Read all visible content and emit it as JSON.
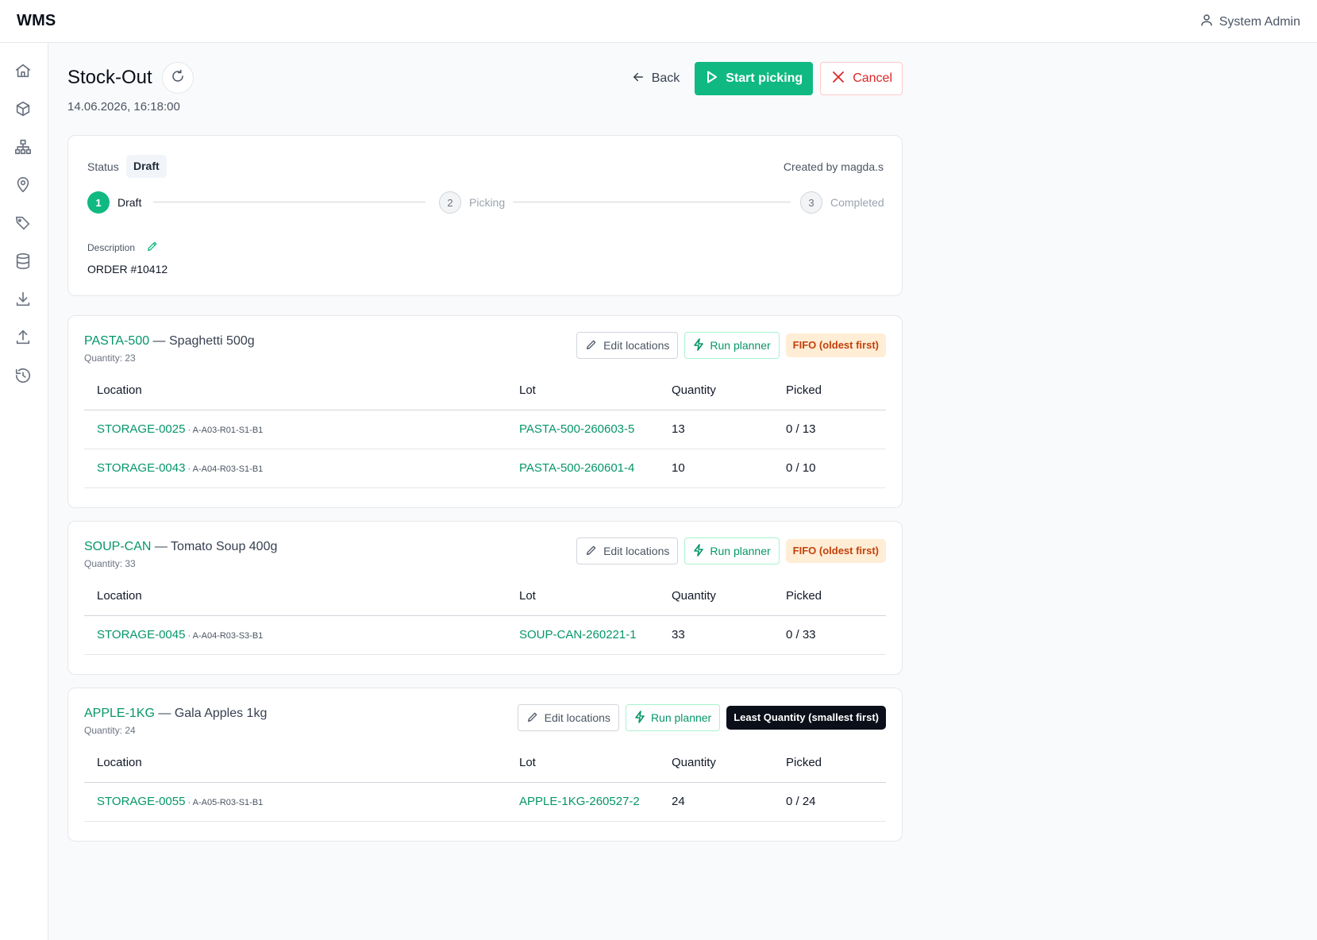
{
  "app": {
    "brand": "WMS",
    "user": "System Admin"
  },
  "sidebar": {
    "items": [
      {
        "icon": "home-icon"
      },
      {
        "icon": "box-icon"
      },
      {
        "icon": "hierarchy-icon"
      },
      {
        "icon": "location-pin-icon"
      },
      {
        "icon": "tags-icon"
      },
      {
        "icon": "database-icon"
      },
      {
        "icon": "download-icon"
      },
      {
        "icon": "upload-icon"
      },
      {
        "icon": "history-icon"
      }
    ]
  },
  "page": {
    "title": "Stock-Out",
    "timestamp": "14.06.2026, 16:18:00",
    "actions": {
      "back": "Back",
      "start": "Start picking",
      "cancel": "Cancel"
    }
  },
  "status": {
    "label": "Status",
    "value": "Draft",
    "created_by": "Created by magda.s",
    "steps": [
      {
        "num": "1",
        "label": "Draft",
        "state": "active"
      },
      {
        "num": "2",
        "label": "Picking",
        "state": "idle"
      },
      {
        "num": "3",
        "label": "Completed",
        "state": "idle"
      }
    ],
    "description_label": "Description",
    "description": "ORDER #10412"
  },
  "colors": {
    "accent": "#10b981",
    "link": "#059669",
    "danger": "#dc2626",
    "fifo_bg": "#ffedd5",
    "fifo_fg": "#c2410c"
  },
  "table_headers": {
    "location": "Location",
    "lot": "Lot",
    "quantity": "Quantity",
    "picked": "Picked"
  },
  "item_buttons": {
    "edit": "Edit locations",
    "run": "Run planner"
  },
  "items": [
    {
      "sku": "PASTA-500",
      "name": " — Spaghetti 500g",
      "quantity": "Quantity: 23",
      "strategy": "FIFO (oldest first)",
      "rows": [
        {
          "location": "STORAGE-0025",
          "code": " · A-A03-R01-S1-B1",
          "lot": "PASTA-500-260603-5",
          "qty": "13",
          "picked": "0 / 13"
        },
        {
          "location": "STORAGE-0043",
          "code": " · A-A04-R03-S1-B1",
          "lot": "PASTA-500-260601-4",
          "qty": "10",
          "picked": "0 / 10"
        }
      ]
    },
    {
      "sku": "SOUP-CAN",
      "name": " — Tomato Soup 400g",
      "quantity": "Quantity: 33",
      "strategy": "FIFO (oldest first)",
      "rows": [
        {
          "location": "STORAGE-0045",
          "code": " · A-A04-R03-S3-B1",
          "lot": "SOUP-CAN-260221-1",
          "qty": "33",
          "picked": "0 / 33"
        }
      ]
    },
    {
      "sku": "APPLE-1KG",
      "name": " — Gala Apples 1kg",
      "quantity": "Quantity: 24",
      "strategy": "Least Quantity (smallest first)",
      "rows": [
        {
          "location": "STORAGE-0055",
          "code": " · A-A05-R03-S1-B1",
          "lot": "APPLE-1KG-260527-2",
          "qty": "24",
          "picked": "0 / 24"
        }
      ]
    }
  ]
}
